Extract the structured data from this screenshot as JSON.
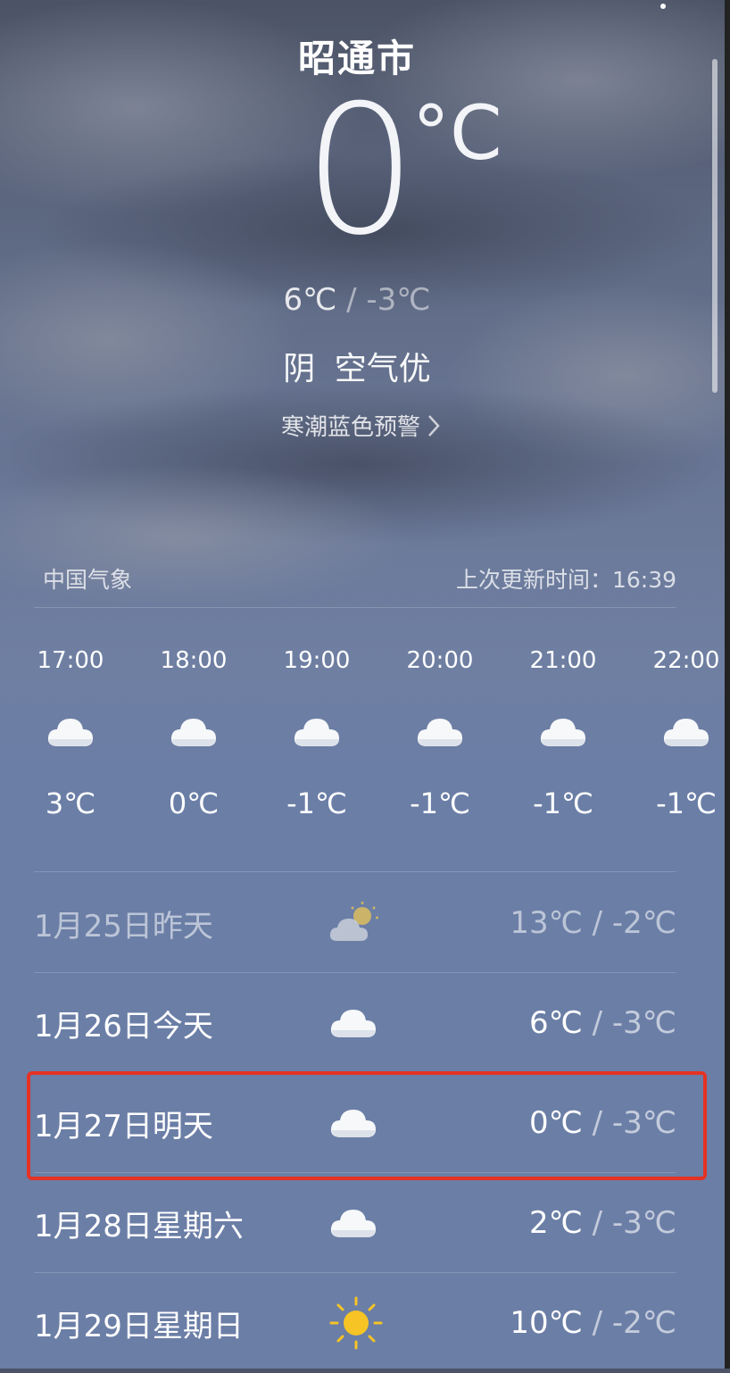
{
  "header": {
    "city": "昭通市",
    "current_temp": "0",
    "unit": "°C",
    "high": "6℃",
    "separator": "/",
    "low": "-3℃",
    "condition": "阴",
    "air_quality": "空气优",
    "alert": "寒潮蓝色预警"
  },
  "meta": {
    "source": "中国气象",
    "updated": "上次更新时间：16:39"
  },
  "hourly": [
    {
      "time": "17:00",
      "temp": "3℃",
      "icon": "cloud-icon"
    },
    {
      "time": "18:00",
      "temp": "0℃",
      "icon": "cloud-icon"
    },
    {
      "time": "19:00",
      "temp": "-1℃",
      "icon": "cloud-icon"
    },
    {
      "time": "20:00",
      "temp": "-1℃",
      "icon": "cloud-icon"
    },
    {
      "time": "21:00",
      "temp": "-1℃",
      "icon": "cloud-icon"
    },
    {
      "time": "22:00",
      "temp": "-1℃",
      "icon": "cloud-icon"
    }
  ],
  "daily": [
    {
      "date": "1月25日昨天",
      "icon": "partly-cloudy-icon",
      "high": "13℃",
      "sep": "/",
      "low": "-2℃"
    },
    {
      "date": "1月26日今天",
      "icon": "cloud-icon",
      "high": "6℃",
      "sep": "/",
      "low": "-3℃"
    },
    {
      "date": "1月27日明天",
      "icon": "cloud-icon",
      "high": "0℃",
      "sep": "/",
      "low": "-3℃"
    },
    {
      "date": "1月28日星期六",
      "icon": "cloud-icon",
      "high": "2℃",
      "sep": "/",
      "low": "-3℃"
    },
    {
      "date": "1月29日星期日",
      "icon": "sun-icon",
      "high": "10℃",
      "sep": "/",
      "low": "-2℃"
    }
  ],
  "colors": {
    "highlight": "#e53224",
    "sun": "#f6c425"
  }
}
